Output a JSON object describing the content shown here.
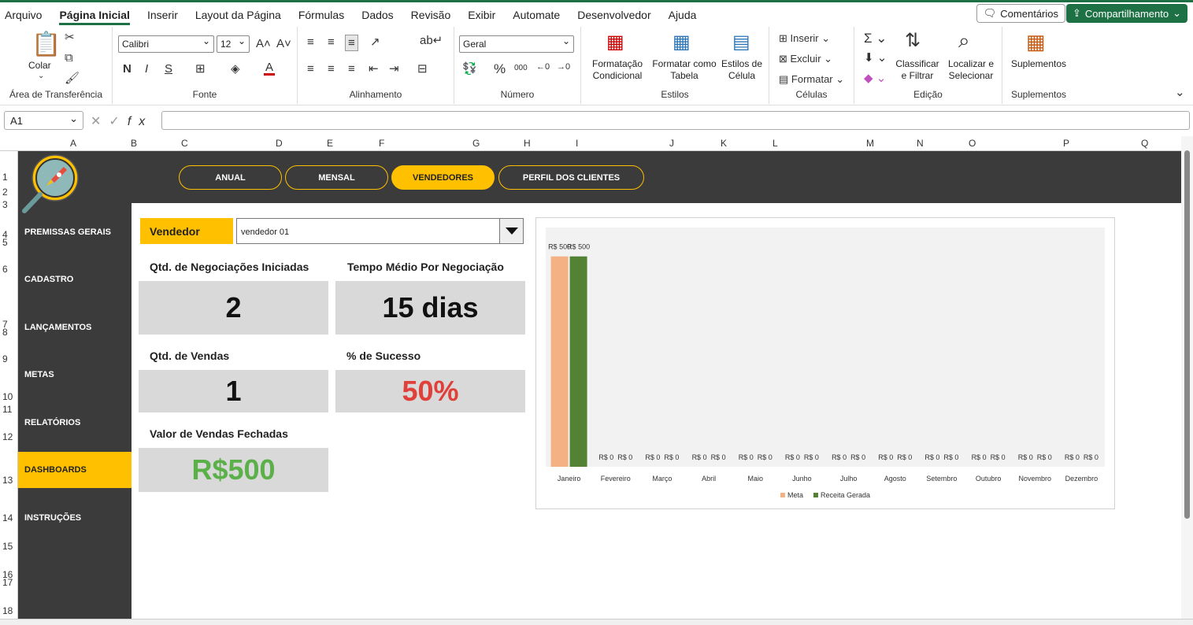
{
  "menu": {
    "items": [
      "Arquivo",
      "Página Inicial",
      "Inserir",
      "Layout da Página",
      "Fórmulas",
      "Dados",
      "Revisão",
      "Exibir",
      "Automate",
      "Desenvolvedor",
      "Ajuda"
    ],
    "active": 1,
    "comments": "Comentários",
    "share": "Compartilhamento"
  },
  "ribbon": {
    "clipboard": {
      "paste": "Colar",
      "group": "Área de Transferência"
    },
    "font": {
      "name": "Calibri",
      "size": "12",
      "group": "Fonte"
    },
    "alignment": {
      "group": "Alinhamento"
    },
    "number": {
      "format": "Geral",
      "group": "Número"
    },
    "styles": {
      "cond1": "Formatação",
      "cond2": "Condicional",
      "table1": "Formatar como",
      "table2": "Tabela",
      "cell1": "Estilos de",
      "cell2": "Célula",
      "group": "Estilos"
    },
    "cells": {
      "insert": "Inserir",
      "delete": "Excluir",
      "format": "Formatar",
      "group": "Células"
    },
    "editing": {
      "sort1": "Classificar",
      "sort2": "e Filtrar",
      "find1": "Localizar e",
      "find2": "Selecionar",
      "group": "Edição"
    },
    "addins": {
      "label": "Suplementos",
      "group": "Suplementos"
    }
  },
  "formula": {
    "namebox": "A1",
    "fx": "fx"
  },
  "columns": [
    "A",
    "B",
    "C",
    "D",
    "E",
    "F",
    "G",
    "H",
    "I",
    "J",
    "K",
    "L",
    "M",
    "N",
    "O",
    "P",
    "Q"
  ],
  "rows": [
    "1",
    "2",
    "3",
    "4",
    "5",
    "6",
    "7",
    "8",
    "9",
    "10",
    "11",
    "12",
    "13",
    "14",
    "15",
    "16",
    "17",
    "18"
  ],
  "tabs": [
    "ANUAL",
    "MENSAL",
    "VENDEDORES",
    "PERFIL DOS CLIENTES"
  ],
  "nav": [
    "PREMISSAS GERAIS",
    "CADASTRO",
    "LANÇAMENTOS",
    "METAS",
    "RELATÓRIOS",
    "DASHBOARDS",
    "INSTRUÇÕES"
  ],
  "seller": {
    "label": "Vendedor",
    "value": "vendedor 01"
  },
  "kpi": {
    "neg_label": "Qtd. de Negociações Iniciadas",
    "neg_value": "2",
    "time_label": "Tempo Médio Por Negociação",
    "time_value": "15 dias",
    "sales_label": "Qtd. de Vendas",
    "sales_value": "1",
    "success_label": "% de Sucesso",
    "success_value": "50%",
    "total_label": "Valor de Vendas Fechadas",
    "total_value": "R$500"
  },
  "colors": {
    "accent": "#ffc000",
    "dark": "#3b3b3b",
    "meta": "#f4b183",
    "receita": "#548235",
    "success": "#e0403a",
    "total": "#5bb04a"
  },
  "chart_data": {
    "type": "bar",
    "categories": [
      "Janeiro",
      "Fevereiro",
      "Março",
      "Abril",
      "Maio",
      "Junho",
      "Julho",
      "Agosto",
      "Setembro",
      "Outubro",
      "Novembro",
      "Dezembro"
    ],
    "series": [
      {
        "name": "Meta",
        "values": [
          500,
          0,
          0,
          0,
          0,
          0,
          0,
          0,
          0,
          0,
          0,
          0
        ],
        "labels": [
          "R$ 500",
          "R$ 0",
          "R$ 0",
          "R$ 0",
          "R$ 0",
          "R$ 0",
          "R$ 0",
          "R$ 0",
          "R$ 0",
          "R$ 0",
          "R$ 0",
          "R$ 0"
        ]
      },
      {
        "name": "Receita Gerada",
        "values": [
          500,
          0,
          0,
          0,
          0,
          0,
          0,
          0,
          0,
          0,
          0,
          0
        ],
        "labels": [
          "R$ 500",
          "R$ 0",
          "R$ 0",
          "R$ 0",
          "R$ 0",
          "R$ 0",
          "R$ 0",
          "R$ 0",
          "R$ 0",
          "R$ 0",
          "R$ 0",
          "R$ 0"
        ]
      }
    ],
    "ylim": [
      0,
      550
    ],
    "legend": "bottom",
    "grid": false
  }
}
